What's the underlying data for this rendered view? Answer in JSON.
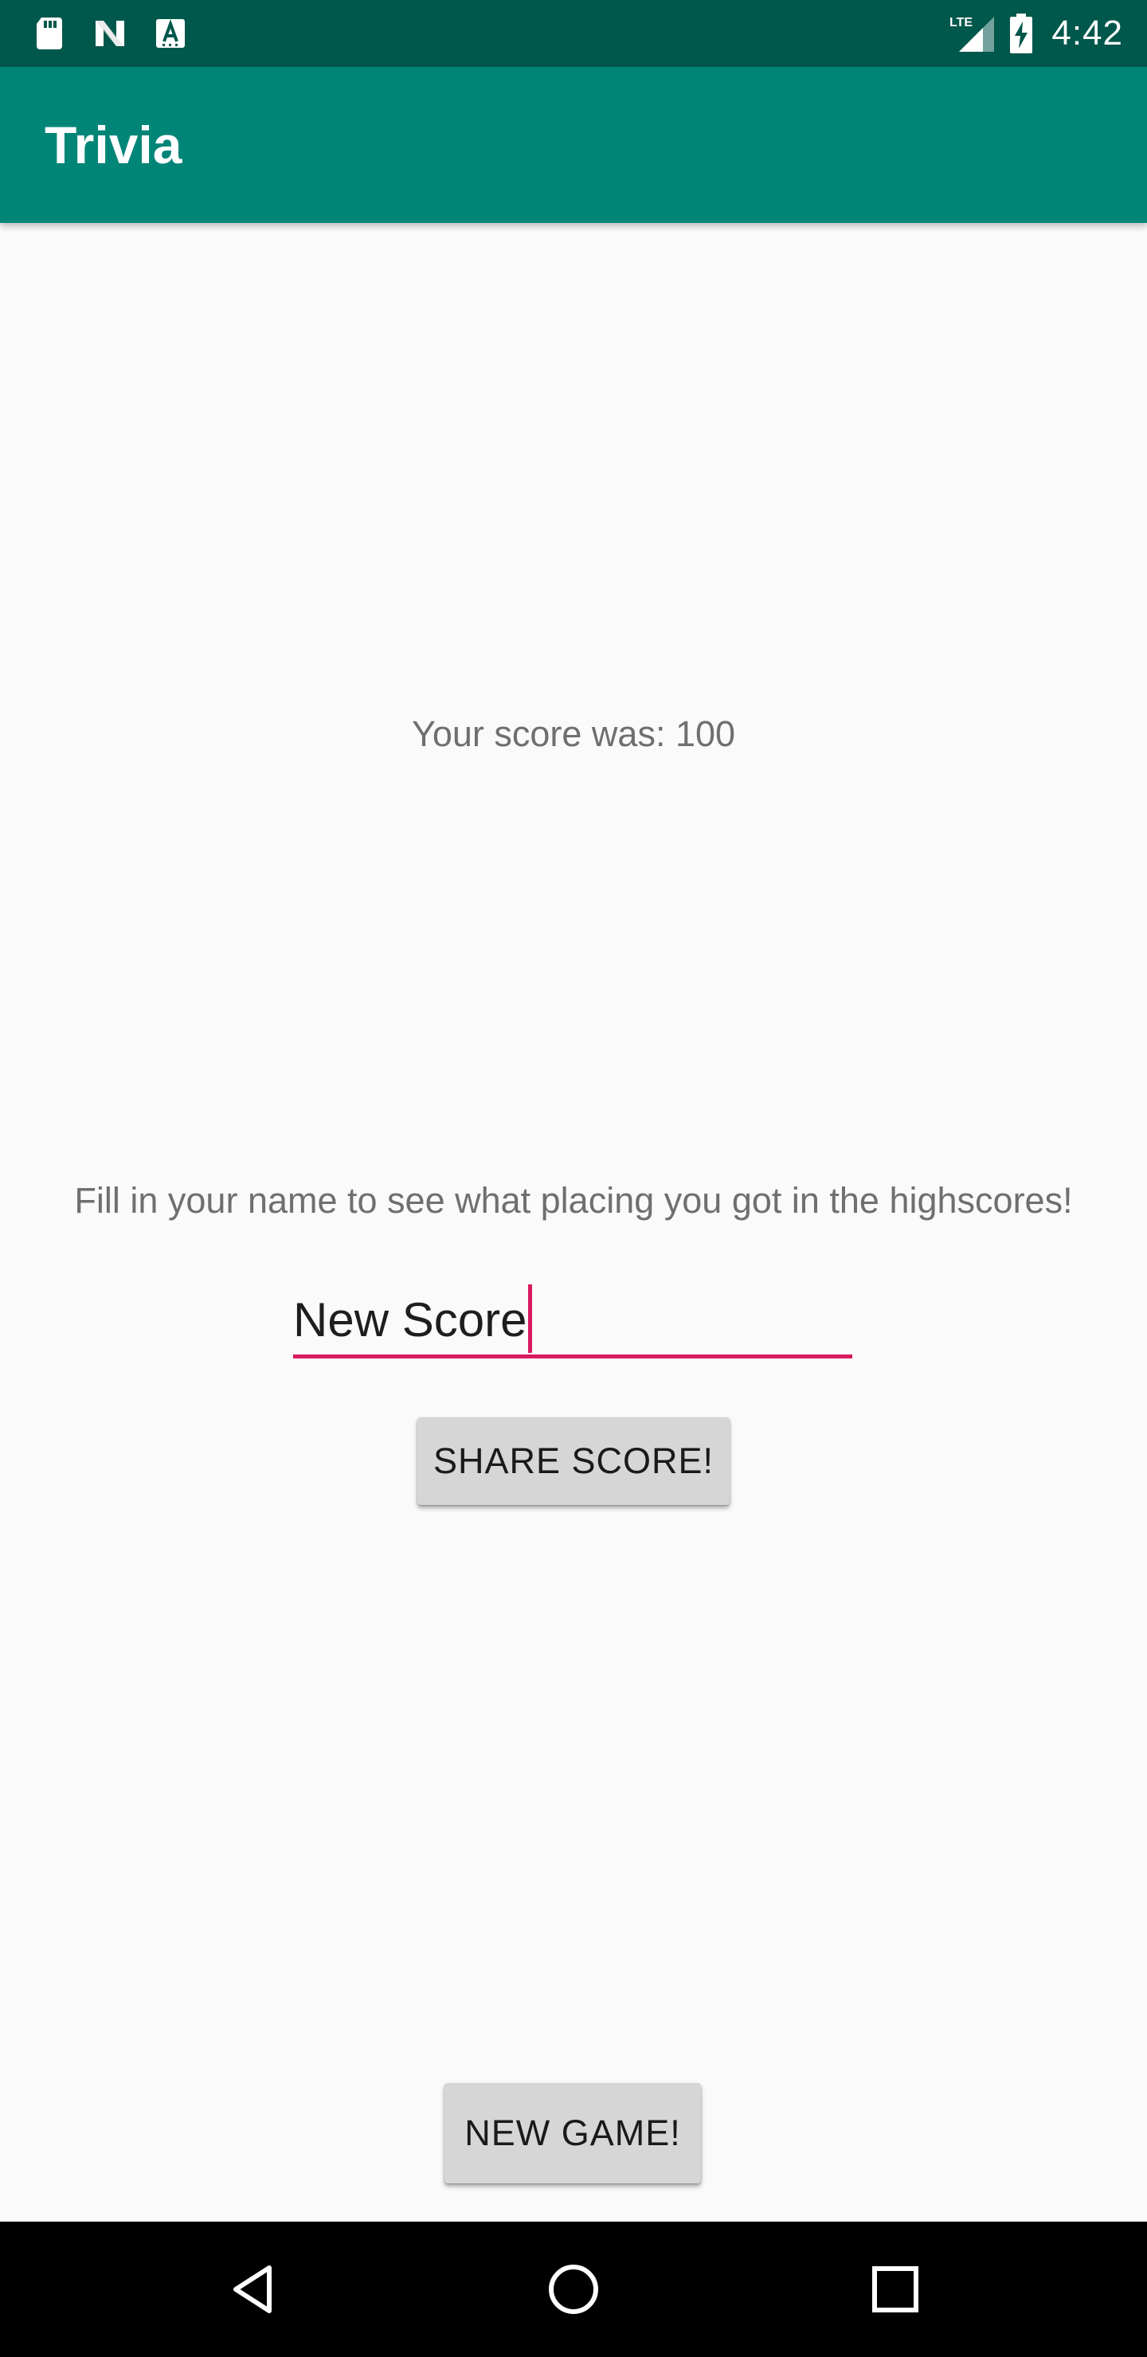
{
  "status_bar": {
    "time": "4:42",
    "network": "LTE",
    "icons": [
      "sd-card-icon",
      "n-notification-icon",
      "a-notification-icon",
      "lte-signal-icon",
      "battery-charging-icon"
    ]
  },
  "app_bar": {
    "title": "Trivia"
  },
  "main": {
    "score_text": "Your score was: 100",
    "prompt_text": "Fill in your name to see what placing you got in the highscores!",
    "name_input_value": "New Score",
    "share_button_label": "SHARE SCORE!",
    "new_game_button_label": "NEW GAME!"
  },
  "nav_bar": {
    "icons": [
      "back-icon",
      "home-icon",
      "recents-icon"
    ]
  },
  "colors": {
    "status_bar": "#00574B",
    "app_bar": "#008577",
    "accent": "#D81B60",
    "background": "#FAFAFA",
    "button": "#D6D6D6"
  }
}
